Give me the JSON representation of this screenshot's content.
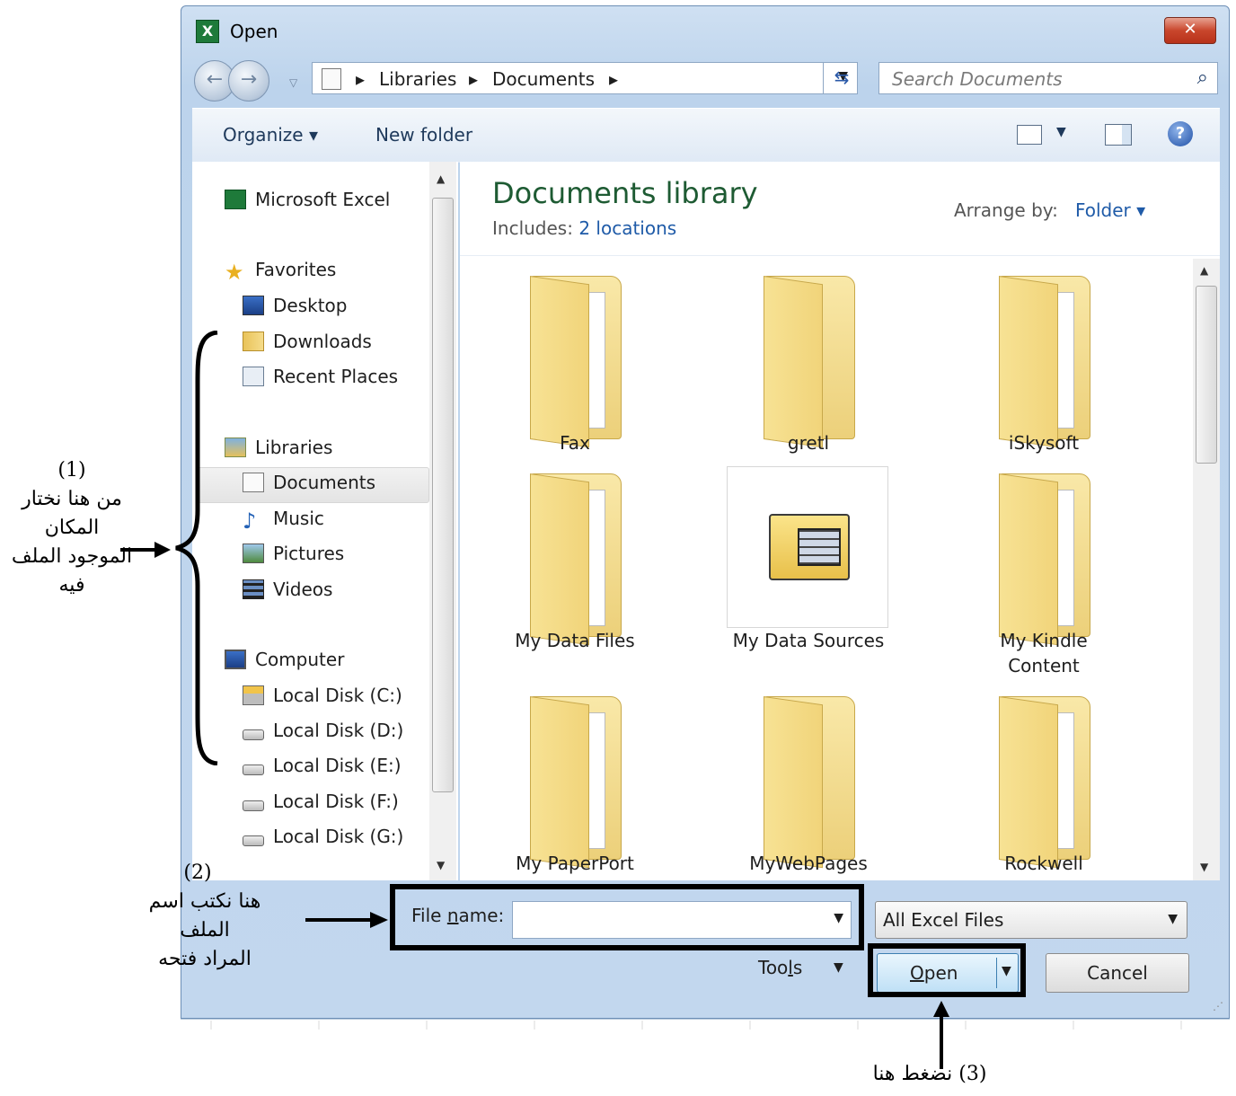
{
  "window": {
    "title": "Open",
    "close_glyph": "✕",
    "app_icon_letter": "X"
  },
  "address": {
    "sep": "▸",
    "crumbs": [
      "Libraries",
      "Documents"
    ],
    "search_placeholder": "Search Documents"
  },
  "toolbar": {
    "organize": "Organize ▾",
    "new_folder": "New folder",
    "help": "?"
  },
  "nav": {
    "app": "Microsoft Excel",
    "favorites": "Favorites",
    "desktop": "Desktop",
    "downloads": "Downloads",
    "recent_places": "Recent Places",
    "libraries": "Libraries",
    "documents": "Documents",
    "music": "Music",
    "pictures": "Pictures",
    "videos": "Videos",
    "computer": "Computer",
    "disk_c": "Local Disk (C:)",
    "disk_d": "Local Disk (D:)",
    "disk_e": "Local Disk (E:)",
    "disk_f": "Local Disk (F:)",
    "disk_g": "Local Disk (G:)"
  },
  "content": {
    "library_title": "Documents library",
    "includes_label": "Includes:",
    "includes_link": "2 locations",
    "arrange_label": "Arrange by:",
    "arrange_value": "Folder ▾",
    "folders": {
      "fax": "Fax",
      "gretl": "gretl",
      "iskysoft": "iSkysoft",
      "my_data_files": "My Data Files",
      "my_data_sources": "My Data Sources",
      "my_kindle_1": "My Kindle",
      "my_kindle_2": "Content",
      "my_paperport": "My PaperPort",
      "mywebpages": "MyWebPages",
      "rockwell": "Rockwell"
    }
  },
  "bottom": {
    "file_name_pre": "File ",
    "file_name_u": "n",
    "file_name_post": "ame:",
    "file_name_value": "",
    "file_type": "All Excel Files",
    "tools_pre": "Too",
    "tools_u": "l",
    "tools_post": "s",
    "open_u": "O",
    "open_post": "pen",
    "cancel": "Cancel"
  },
  "annotations": {
    "note1_num": "(1)",
    "note1_l1": "من هنا نختار",
    "note1_l2": "المكان",
    "note1_l3": "الموجود الملف",
    "note1_l4": "فيه",
    "note2_num": "(2)",
    "note2_l1": "هنا نكتب اسم",
    "note2_l2": "الملف",
    "note2_l3": "المراد فتحه",
    "note3": "(3) نضغط هنا"
  },
  "colors": {
    "accent_blue": "#1f5ba8",
    "library_title_green": "#1e5b33",
    "close_red": "#c9462c"
  }
}
